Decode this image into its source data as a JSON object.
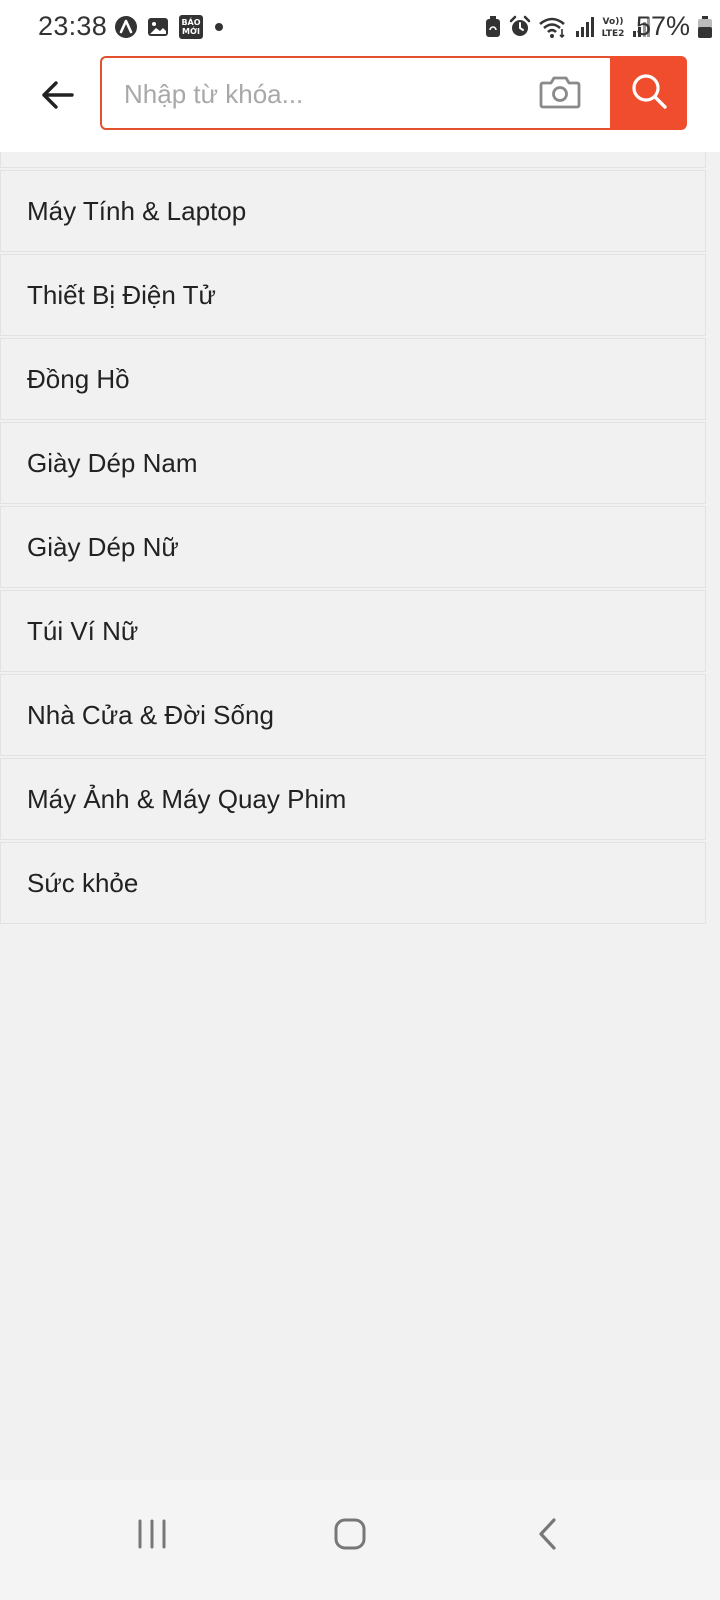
{
  "status_bar": {
    "time": "23:38",
    "battery_percent": "57%",
    "left_icons": [
      "app-a-icon",
      "gallery-icon",
      "baomoi-icon",
      "dot-icon"
    ],
    "baomoi_text": "BÁO MỚI",
    "right_icons": [
      "battery-saver-icon",
      "alarm-icon",
      "wifi-icon",
      "signal-icon",
      "volte-lte2-icon",
      "signal-icon"
    ],
    "volte_text": "Vo)) LTE2"
  },
  "header": {
    "search_placeholder": "Nhập từ khóa...",
    "search_value": "",
    "accent_color": "#ef4d2d"
  },
  "categories": [
    "Máy Tính & Laptop",
    "Thiết Bị Điện Tử",
    "Đồng Hồ",
    "Giày Dép Nam",
    "Giày Dép Nữ",
    "Túi Ví Nữ",
    "Nhà Cửa & Đời Sống",
    "Máy Ảnh & Máy Quay Phim",
    "Sức khỏe"
  ],
  "nav_bar": {
    "buttons": [
      "recent-apps-icon",
      "home-icon",
      "back-icon"
    ]
  }
}
